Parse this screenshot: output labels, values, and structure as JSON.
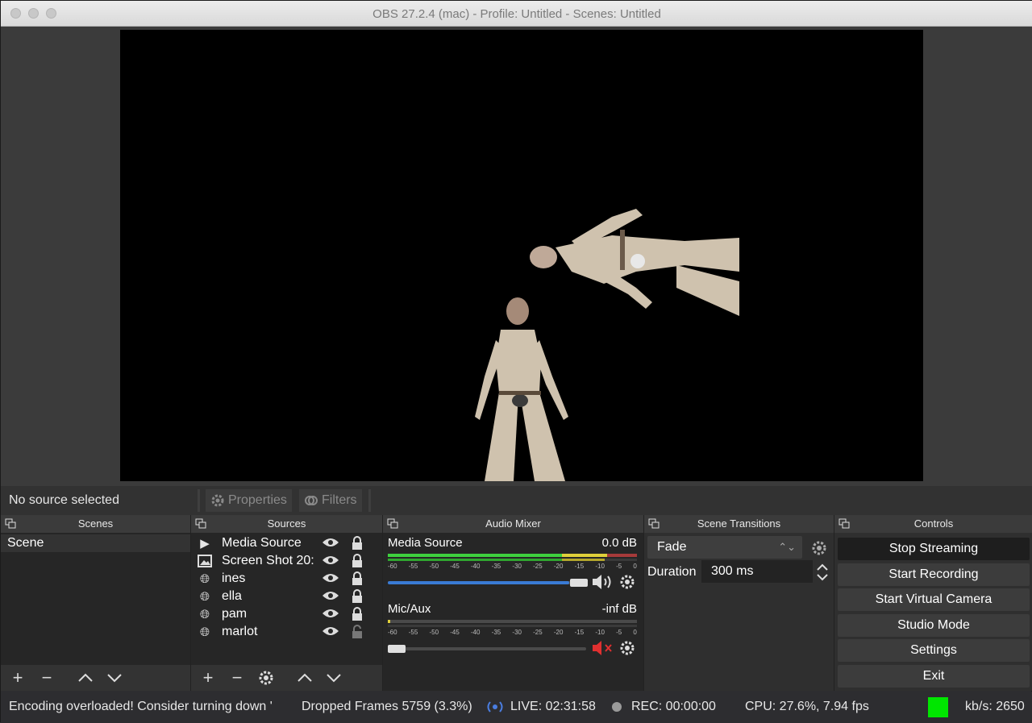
{
  "window": {
    "title": "OBS 27.2.4 (mac) - Profile: Untitled - Scenes: Untitled"
  },
  "source_bar": {
    "no_source": "No source selected",
    "properties": "Properties",
    "filters": "Filters"
  },
  "scenes": {
    "header": "Scenes",
    "items": [
      "Scene"
    ]
  },
  "sources": {
    "header": "Sources",
    "items": [
      {
        "name": "Media Source",
        "icon": "play-icon",
        "locked": true
      },
      {
        "name": "Screen Shot 20:",
        "icon": "image-icon",
        "locked": true
      },
      {
        "name": "ines",
        "icon": "globe-icon",
        "locked": true
      },
      {
        "name": "ella",
        "icon": "globe-icon",
        "locked": true
      },
      {
        "name": "pam",
        "icon": "globe-icon",
        "locked": true
      },
      {
        "name": "marlot",
        "icon": "globe-icon",
        "locked": false
      }
    ]
  },
  "mixer": {
    "header": "Audio Mixer",
    "tracks": [
      {
        "name": "Media Source",
        "db": "0.0 dB",
        "level": 0.88,
        "muted": false
      },
      {
        "name": "Mic/Aux",
        "db": "-inf dB",
        "level": 0.04,
        "muted": true
      }
    ],
    "scale": [
      "-60",
      "-55",
      "-50",
      "-45",
      "-40",
      "-35",
      "-30",
      "-25",
      "-20",
      "-15",
      "-10",
      "-5",
      "0"
    ]
  },
  "transitions": {
    "header": "Scene Transitions",
    "selected": "Fade",
    "duration_label": "Duration",
    "duration_value": "300 ms"
  },
  "controls": {
    "header": "Controls",
    "buttons": [
      "Stop Streaming",
      "Start Recording",
      "Start Virtual Camera",
      "Studio Mode",
      "Settings",
      "Exit"
    ]
  },
  "status": {
    "message": "Encoding overloaded! Consider turning down '",
    "dropped": "Dropped Frames 5759 (3.3%)",
    "live": "LIVE: 02:31:58",
    "rec": "REC: 00:00:00",
    "cpu": "CPU: 27.6%, 7.94 fps",
    "kbps": "kb/s: 2650",
    "stream_color": "#00e600"
  }
}
